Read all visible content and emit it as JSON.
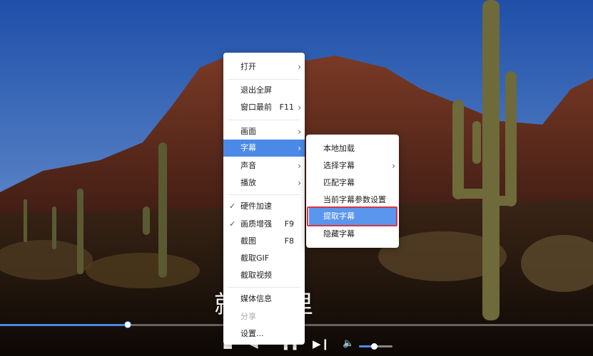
{
  "subtitle": "就在这里",
  "main_menu": [
    {
      "label": "打开",
      "arrow": "›"
    },
    {
      "label": "退出全屏"
    },
    {
      "label": "窗口最前",
      "shortcut": "F11",
      "arrow": "›"
    },
    {
      "label": "画面",
      "arrow": "›"
    },
    {
      "label": "字幕",
      "arrow": "›",
      "state": "highlighted"
    },
    {
      "label": "声音",
      "arrow": "›"
    },
    {
      "label": "播放",
      "arrow": "›"
    },
    {
      "label": "硬件加速",
      "checked": true
    },
    {
      "label": "画质增强",
      "shortcut": "F9",
      "checked": true
    },
    {
      "label": "截图",
      "shortcut": "F8"
    },
    {
      "label": "截取GIF"
    },
    {
      "label": "截取视频"
    },
    {
      "label": "媒体信息"
    },
    {
      "label": "分享",
      "state": "disabled"
    },
    {
      "label": "设置..."
    }
  ],
  "subtitle_submenu": [
    {
      "label": "本地加载"
    },
    {
      "label": "选择字幕",
      "arrow": "›"
    },
    {
      "label": "匹配字幕"
    },
    {
      "label": "当前字幕参数设置"
    },
    {
      "label": "提取字幕",
      "state": "selected"
    },
    {
      "label": "隐藏字幕"
    }
  ],
  "playback": {
    "progress_fraction": 0.215,
    "volume_fraction": 0.45
  },
  "colors": {
    "accent": "#4b89e6",
    "selection_outline": "#d8353f"
  },
  "icons": {
    "check": "✓",
    "prev": "◀",
    "play_pause": "❚❚",
    "next": "▶❙",
    "volume": "🔈"
  }
}
